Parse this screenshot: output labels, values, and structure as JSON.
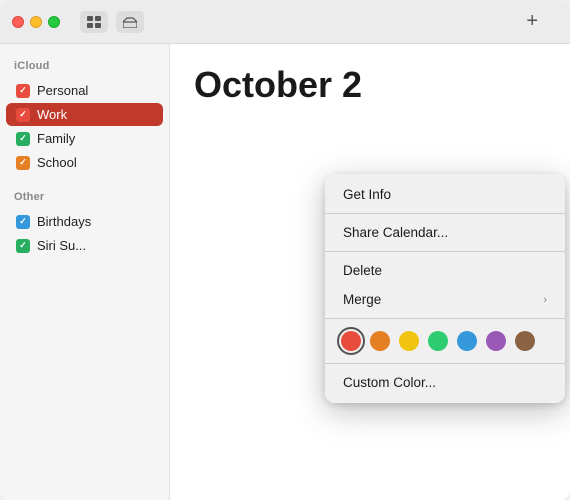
{
  "titlebar": {
    "add_label": "+"
  },
  "sidebar": {
    "icloud_label": "iCloud",
    "other_label": "Other",
    "items": [
      {
        "id": "personal",
        "label": "Personal",
        "color": "red",
        "selected": false
      },
      {
        "id": "work",
        "label": "Work",
        "color": "red",
        "selected": true
      },
      {
        "id": "family",
        "label": "Family",
        "color": "green",
        "selected": false
      },
      {
        "id": "school",
        "label": "School",
        "color": "orange",
        "selected": false
      },
      {
        "id": "birthdays",
        "label": "Birthdays",
        "color": "blue",
        "selected": false
      },
      {
        "id": "siri-suggestions",
        "label": "Siri Su...",
        "color": "green",
        "selected": false
      }
    ]
  },
  "calendar": {
    "month_title": "October 2"
  },
  "context_menu": {
    "get_info": "Get Info",
    "share_calendar": "Share Calendar...",
    "delete": "Delete",
    "merge": "Merge",
    "custom_color": "Custom Color...",
    "colors": [
      {
        "name": "red",
        "hex": "#e74c3c",
        "selected": true
      },
      {
        "name": "orange",
        "hex": "#e67e22",
        "selected": false
      },
      {
        "name": "yellow",
        "hex": "#f1c40f",
        "selected": false
      },
      {
        "name": "green",
        "hex": "#2ecc71",
        "selected": false
      },
      {
        "name": "blue",
        "hex": "#3498db",
        "selected": false
      },
      {
        "name": "purple",
        "hex": "#9b59b6",
        "selected": false
      },
      {
        "name": "brown",
        "hex": "#8B6343",
        "selected": false
      }
    ]
  }
}
